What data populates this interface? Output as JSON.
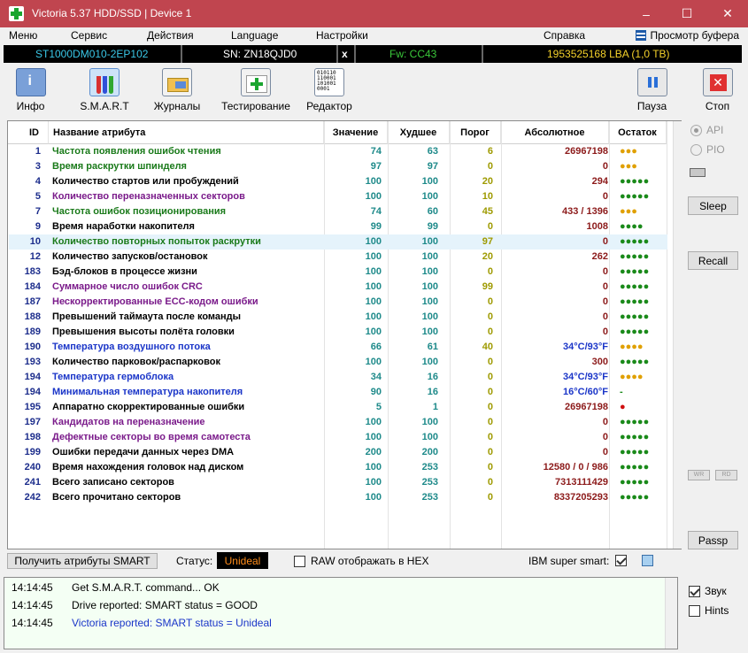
{
  "window": {
    "title": "Victoria 5.37 HDD/SSD | Device 1"
  },
  "menu": {
    "items": [
      "Меню",
      "Сервис",
      "Действия",
      "Language",
      "Настройки",
      "Справка"
    ],
    "buffer_view": "Просмотр буфера"
  },
  "device": {
    "model": "ST1000DM010-2EP102",
    "serial": "SN: ZN18QJD0",
    "close": "x",
    "firmware": "Fw: CC43",
    "capacity": "1953525168 LBA (1,0 TB)"
  },
  "toolbar": {
    "info": "Инфо",
    "smart": "S.M.A.R.T",
    "logs": "Журналы",
    "test": "Тестирование",
    "editor": "Редактор",
    "pause": "Пауза",
    "stop": "Стоп"
  },
  "grid": {
    "headers": {
      "id": "ID",
      "name": "Название атрибута",
      "value": "Значение",
      "worst": "Худшее",
      "threshold": "Порог",
      "raw": "Абсолютное",
      "left": "Остаток"
    },
    "rows": [
      {
        "id": "1",
        "name": "Частота появления ошибок чтения",
        "value": "74",
        "worst": "63",
        "threshold": "6",
        "raw": "26967198",
        "left": "●●●",
        "name_color": "#1a7a1a",
        "left_color": "#e0a000"
      },
      {
        "id": "3",
        "name": "Время раскрутки шпинделя",
        "value": "97",
        "worst": "97",
        "threshold": "0",
        "raw": "0",
        "left": "●●●",
        "name_color": "#1a7a1a",
        "left_color": "#e0a000"
      },
      {
        "id": "4",
        "name": "Количество стартов или пробуждений",
        "value": "100",
        "worst": "100",
        "threshold": "20",
        "raw": "294",
        "left": "●●●●●",
        "name_color": "#000000",
        "left_color": "#1a8a1a"
      },
      {
        "id": "5",
        "name": "Количество переназначенных секторов",
        "value": "100",
        "worst": "100",
        "threshold": "10",
        "raw": "0",
        "left": "●●●●●",
        "name_color": "#7a1a8a",
        "left_color": "#1a8a1a"
      },
      {
        "id": "7",
        "name": "Частота ошибок позиционирования",
        "value": "74",
        "worst": "60",
        "threshold": "45",
        "raw": "433 / 1396",
        "left": "●●●",
        "name_color": "#1a7a1a",
        "left_color": "#e0a000"
      },
      {
        "id": "9",
        "name": "Время наработки накопителя",
        "value": "99",
        "worst": "99",
        "threshold": "0",
        "raw": "1008",
        "left": "●●●●",
        "name_color": "#000000",
        "left_color": "#1a8a1a"
      },
      {
        "id": "10",
        "name": "Количество повторных попыток раскрутки",
        "value": "100",
        "worst": "100",
        "threshold": "97",
        "raw": "0",
        "left": "●●●●●",
        "name_color": "#1a7a1a",
        "left_color": "#1a8a1a"
      },
      {
        "id": "12",
        "name": "Количество запусков/остановок",
        "value": "100",
        "worst": "100",
        "threshold": "20",
        "raw": "262",
        "left": "●●●●●",
        "name_color": "#000000",
        "left_color": "#1a8a1a"
      },
      {
        "id": "183",
        "name": "Бэд-блоков в процессе жизни",
        "value": "100",
        "worst": "100",
        "threshold": "0",
        "raw": "0",
        "left": "●●●●●",
        "name_color": "#000000",
        "left_color": "#1a8a1a"
      },
      {
        "id": "184",
        "name": "Суммарное число ошибок CRC",
        "value": "100",
        "worst": "100",
        "threshold": "99",
        "raw": "0",
        "left": "●●●●●",
        "name_color": "#7a1a8a",
        "left_color": "#1a8a1a"
      },
      {
        "id": "187",
        "name": "Нескорректированные ECC-кодом ошибки",
        "value": "100",
        "worst": "100",
        "threshold": "0",
        "raw": "0",
        "left": "●●●●●",
        "name_color": "#7a1a8a",
        "left_color": "#1a8a1a"
      },
      {
        "id": "188",
        "name": "Превышений таймаута после команды",
        "value": "100",
        "worst": "100",
        "threshold": "0",
        "raw": "0",
        "left": "●●●●●",
        "name_color": "#000000",
        "left_color": "#1a8a1a"
      },
      {
        "id": "189",
        "name": "Превышения высоты полёта головки",
        "value": "100",
        "worst": "100",
        "threshold": "0",
        "raw": "0",
        "left": "●●●●●",
        "name_color": "#000000",
        "left_color": "#1a8a1a"
      },
      {
        "id": "190",
        "name": "Температура воздушного потока",
        "value": "66",
        "worst": "61",
        "threshold": "40",
        "raw": "34°C/93°F",
        "left": "●●●●",
        "name_color": "#1a35c8",
        "left_color": "#e0a000",
        "raw_color": "#1a35c8"
      },
      {
        "id": "193",
        "name": "Количество парковок/распарковок",
        "value": "100",
        "worst": "100",
        "threshold": "0",
        "raw": "300",
        "left": "●●●●●",
        "name_color": "#000000",
        "left_color": "#1a8a1a"
      },
      {
        "id": "194",
        "name": "Температура гермоблока",
        "value": "34",
        "worst": "16",
        "threshold": "0",
        "raw": "34°C/93°F",
        "left": "●●●●",
        "name_color": "#1a35c8",
        "left_color": "#e0a000",
        "raw_color": "#1a35c8"
      },
      {
        "id": "194",
        "name": "Минимальная температура накопителя",
        "value": "90",
        "worst": "16",
        "threshold": "0",
        "raw": "16°C/60°F",
        "left": "-",
        "name_color": "#1a35c8",
        "left_color": "#1a8a1a",
        "raw_color": "#1a35c8"
      },
      {
        "id": "195",
        "name": "Аппаратно скорректированные ошибки",
        "value": "5",
        "worst": "1",
        "threshold": "0",
        "raw": "26967198",
        "left": "●",
        "name_color": "#000000",
        "left_color": "#d01010"
      },
      {
        "id": "197",
        "name": "Кандидатов на переназначение",
        "value": "100",
        "worst": "100",
        "threshold": "0",
        "raw": "0",
        "left": "●●●●●",
        "name_color": "#7a1a8a",
        "left_color": "#1a8a1a"
      },
      {
        "id": "198",
        "name": "Дефектные секторы во время самотеста",
        "value": "100",
        "worst": "100",
        "threshold": "0",
        "raw": "0",
        "left": "●●●●●",
        "name_color": "#7a1a8a",
        "left_color": "#1a8a1a"
      },
      {
        "id": "199",
        "name": "Ошибки передачи данных через DMA",
        "value": "200",
        "worst": "200",
        "threshold": "0",
        "raw": "0",
        "left": "●●●●●",
        "name_color": "#000000",
        "left_color": "#1a8a1a"
      },
      {
        "id": "240",
        "name": "Время нахождения головок над диском",
        "value": "100",
        "worst": "253",
        "threshold": "0",
        "raw": "12580 / 0 / 986",
        "left": "●●●●●",
        "name_color": "#000000",
        "left_color": "#1a8a1a"
      },
      {
        "id": "241",
        "name": "Всего записано секторов",
        "value": "100",
        "worst": "253",
        "threshold": "0",
        "raw": "7313111429",
        "left": "●●●●●",
        "name_color": "#000000",
        "left_color": "#1a8a1a"
      },
      {
        "id": "242",
        "name": "Всего прочитано секторов",
        "value": "100",
        "worst": "253",
        "threshold": "0",
        "raw": "8337205293",
        "left": "●●●●●",
        "name_color": "#000000",
        "left_color": "#1a8a1a"
      }
    ]
  },
  "side": {
    "api": "API",
    "pio": "PIO",
    "sleep": "Sleep",
    "recall": "Recall",
    "wr": "WR",
    "rd": "RD",
    "passp": "Passp",
    "sound": "Звук",
    "hints": "Hints"
  },
  "status": {
    "get_smart": "Получить атрибуты SMART",
    "status_label": "Статус:",
    "status_value": "Unideal",
    "raw_hex": "RAW отображать в HEX",
    "ibm": "IBM super smart:"
  },
  "log": [
    {
      "time": "14:14:45",
      "text": "Get S.M.A.R.T. command... OK",
      "color": "#000000"
    },
    {
      "time": "14:14:45",
      "text": "Drive reported: SMART status = GOOD",
      "color": "#000000"
    },
    {
      "time": "14:14:45",
      "text": "Victoria reported: SMART status = Unideal",
      "color": "#1a35c8"
    }
  ],
  "colors": {
    "titlebar": "#c0454f",
    "status_badge_bg": "#000000",
    "status_badge_fg": "#ff8c1a"
  }
}
